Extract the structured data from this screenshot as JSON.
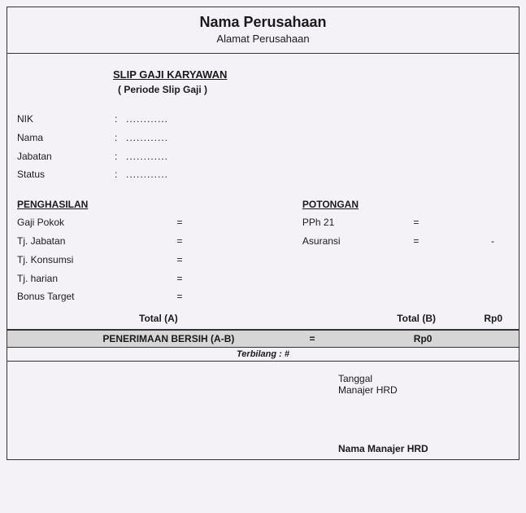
{
  "header": {
    "company_name": "Nama Perusahaan",
    "company_address": "Alamat Perusahaan"
  },
  "title": {
    "main": "SLIP GAJI KARYAWAN",
    "period": "( Periode Slip Gaji )"
  },
  "info": {
    "nik_label": "NIK",
    "nik_value": "............",
    "nama_label": "Nama",
    "nama_value": "............",
    "jabatan_label": "Jabatan",
    "jabatan_value": "............",
    "status_label": "Status",
    "status_value": "............",
    "sep": ":"
  },
  "earnings": {
    "heading": "PENGHASILAN",
    "items": [
      {
        "label": "Gaji Pokok",
        "eq": "=",
        "value": ""
      },
      {
        "label": "Tj. Jabatan",
        "eq": "=",
        "value": ""
      },
      {
        "label": "Tj. Konsumsi",
        "eq": "=",
        "value": ""
      },
      {
        "label": "Tj. harian",
        "eq": "=",
        "value": ""
      },
      {
        "label": "Bonus Target",
        "eq": "=",
        "value": ""
      }
    ],
    "total_label": "Total (A)",
    "total_value": ""
  },
  "deductions": {
    "heading": "POTONGAN",
    "items": [
      {
        "label": "PPh 21",
        "eq": "=",
        "value": ""
      },
      {
        "label": "Asuransi",
        "eq": "=",
        "value": "-"
      }
    ],
    "total_label": "Total (B)",
    "total_value": "Rp0"
  },
  "net": {
    "label": "PENERIMAAN BERSIH (A-B)",
    "eq": "=",
    "value": "Rp0"
  },
  "terbilang": {
    "text": "Terbilang : #"
  },
  "signature": {
    "date_label": "Tanggal",
    "role": "Manajer HRD",
    "name": "Nama Manajer HRD"
  }
}
